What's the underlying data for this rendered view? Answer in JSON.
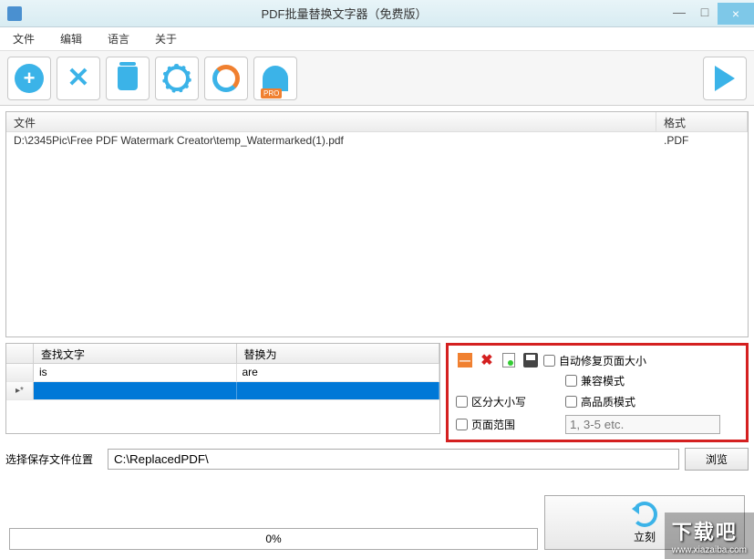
{
  "titlebar": {
    "title": "PDF批量替换文字器（免费版）"
  },
  "menu": {
    "file": "文件",
    "edit": "编辑",
    "lang": "语言",
    "about": "关于"
  },
  "file_list": {
    "col_file": "文件",
    "col_format": "格式",
    "rows": [
      {
        "path": "D:\\2345Pic\\Free PDF Watermark Creator\\temp_Watermarked(1).pdf",
        "format": ".PDF"
      }
    ]
  },
  "replace_grid": {
    "col_find": "查找文字",
    "col_replace": "替换为",
    "rows": [
      {
        "find": "is",
        "replace": "are"
      },
      {
        "find": "",
        "replace": ""
      }
    ]
  },
  "options": {
    "auto_fix_page_size": "自动修复页面大小",
    "compat_mode": "兼容模式",
    "case_sensitive": "区分大小写",
    "high_quality": "高品质模式",
    "page_range": "页面范围",
    "page_range_placeholder": "1, 3-5 etc."
  },
  "output": {
    "label": "选择保存文件位置",
    "path": "C:\\ReplacedPDF\\",
    "browse": "浏览"
  },
  "progress": {
    "text": "0%"
  },
  "action": {
    "label": "立刻"
  },
  "watermark": {
    "big": "下载吧",
    "small": "www.xiazaiba.com"
  }
}
